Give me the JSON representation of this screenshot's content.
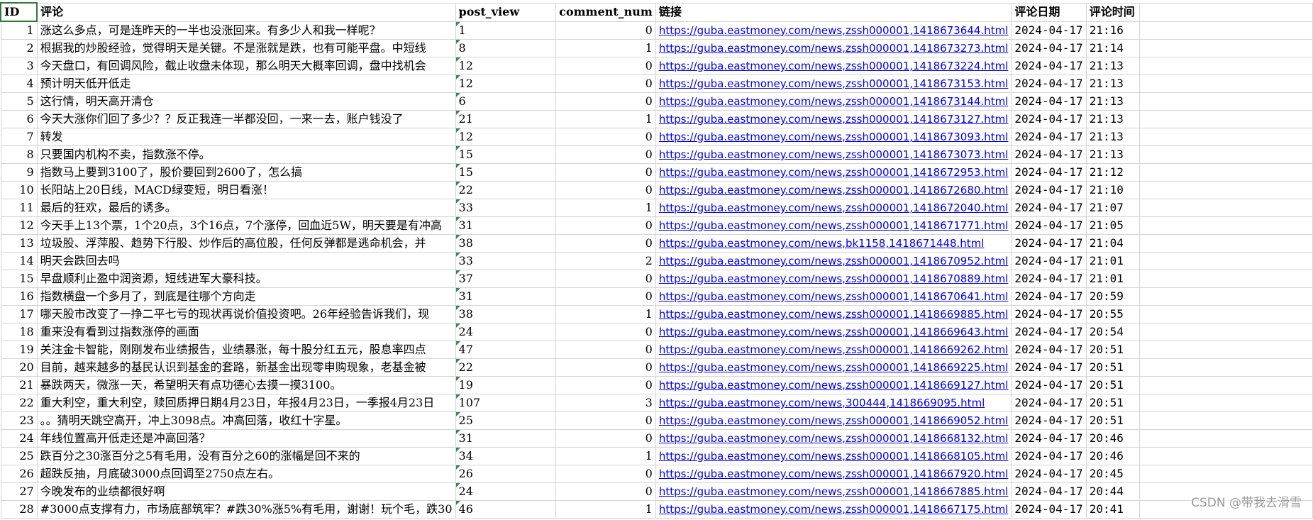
{
  "headers": [
    "ID",
    "评论",
    "post_view",
    "comment_num",
    "链接",
    "评论日期",
    "评论时间"
  ],
  "rows": [
    {
      "id": "1",
      "comment": "涨这么多点，可是连昨天的一半也没涨回来。有多少人和我一样呢？",
      "views": "1",
      "comments": "0",
      "link": "https://guba.eastmoney.com/news,zssh000001,1418673644.html",
      "date": "2024-04-17",
      "time": "21:16"
    },
    {
      "id": "2",
      "comment": "根据我的炒股经验，觉得明天是关键。不是涨就是跌，也有可能平盘。中短线",
      "views": "8",
      "comments": "1",
      "link": "https://guba.eastmoney.com/news,zssh000001,1418673273.html",
      "date": "2024-04-17",
      "time": "21:14"
    },
    {
      "id": "3",
      "comment": "今天盘口，有回调风险，截止收盘未体现，那么明天大概率回调，盘中找机会",
      "views": "12",
      "comments": "0",
      "link": "https://guba.eastmoney.com/news,zssh000001,1418673224.html",
      "date": "2024-04-17",
      "time": "21:13"
    },
    {
      "id": "4",
      "comment": "预计明天低开低走",
      "views": "12",
      "comments": "0",
      "link": "https://guba.eastmoney.com/news,zssh000001,1418673153.html",
      "date": "2024-04-17",
      "time": "21:13"
    },
    {
      "id": "5",
      "comment": "这行情，明天高开清仓",
      "views": "6",
      "comments": "0",
      "link": "https://guba.eastmoney.com/news,zssh000001,1418673144.html",
      "date": "2024-04-17",
      "time": "21:13"
    },
    {
      "id": "6",
      "comment": "今天大涨你们回了多少？？反正我连一半都没回，一来一去，账户钱没了",
      "views": "21",
      "comments": "1",
      "link": "https://guba.eastmoney.com/news,zssh000001,1418673127.html",
      "date": "2024-04-17",
      "time": "21:13"
    },
    {
      "id": "7",
      "comment": "转发",
      "views": "12",
      "comments": "0",
      "link": "https://guba.eastmoney.com/news,zssh000001,1418673093.html",
      "date": "2024-04-17",
      "time": "21:13"
    },
    {
      "id": "8",
      "comment": "只要国内机构不卖，指数涨不停。",
      "views": "15",
      "comments": "0",
      "link": "https://guba.eastmoney.com/news,zssh000001,1418673073.html",
      "date": "2024-04-17",
      "time": "21:13"
    },
    {
      "id": "9",
      "comment": "指数马上要到3100了，股价要回到2600了，怎么搞",
      "views": "15",
      "comments": "0",
      "link": "https://guba.eastmoney.com/news,zssh000001,1418672953.html",
      "date": "2024-04-17",
      "time": "21:12"
    },
    {
      "id": "10",
      "comment": "长阳站上20日线，MACD绿变短，明日看涨！",
      "views": "22",
      "comments": "0",
      "link": "https://guba.eastmoney.com/news,zssh000001,1418672680.html",
      "date": "2024-04-17",
      "time": "21:10"
    },
    {
      "id": "11",
      "comment": "最后的狂欢，最后的诱多。",
      "views": "33",
      "comments": "1",
      "link": "https://guba.eastmoney.com/news,zssh000001,1418672040.html",
      "date": "2024-04-17",
      "time": "21:07"
    },
    {
      "id": "12",
      "comment": "今天手上13个票，1个20点，3个16点，7个涨停，回血近5W，明天要是有冲高",
      "views": "31",
      "comments": "0",
      "link": "https://guba.eastmoney.com/news,zssh000001,1418671771.html",
      "date": "2024-04-17",
      "time": "21:05"
    },
    {
      "id": "13",
      "comment": "垃圾股、浮萍股、趋势下行股、炒作后的高位股，任何反弹都是逃命机会，并",
      "views": "38",
      "comments": "0",
      "link": "https://guba.eastmoney.com/news,bk1158,1418671448.html",
      "date": "2024-04-17",
      "time": "21:04"
    },
    {
      "id": "14",
      "comment": "明天会跌回去吗",
      "views": "33",
      "comments": "2",
      "link": "https://guba.eastmoney.com/news,zssh000001,1418670952.html",
      "date": "2024-04-17",
      "time": "21:01"
    },
    {
      "id": "15",
      "comment": "早盘顺利止盈中润资源，短线进军大豪科技。",
      "views": "37",
      "comments": "0",
      "link": "https://guba.eastmoney.com/news,zssh000001,1418670889.html",
      "date": "2024-04-17",
      "time": "21:01"
    },
    {
      "id": "16",
      "comment": "指数横盘一个多月了，到底是往哪个方向走",
      "views": "31",
      "comments": "0",
      "link": "https://guba.eastmoney.com/news,zssh000001,1418670641.html",
      "date": "2024-04-17",
      "time": "20:59"
    },
    {
      "id": "17",
      "comment": "哪天股市改变了一挣二平七亏的现状再说价值投资吧。26年经验告诉我们，现",
      "views": "38",
      "comments": "1",
      "link": "https://guba.eastmoney.com/news,zssh000001,1418669885.html",
      "date": "2024-04-17",
      "time": "20:55"
    },
    {
      "id": "18",
      "comment": "重来没有看到过指数涨停的画面",
      "views": "24",
      "comments": "0",
      "link": "https://guba.eastmoney.com/news,zssh000001,1418669643.html",
      "date": "2024-04-17",
      "time": "20:54"
    },
    {
      "id": "19",
      "comment": "关注金卡智能，刚刚发布业绩报告，业绩暴涨，每十股分红五元，股息率四点",
      "views": "47",
      "comments": "0",
      "link": "https://guba.eastmoney.com/news,zssh000001,1418669262.html",
      "date": "2024-04-17",
      "time": "20:51"
    },
    {
      "id": "20",
      "comment": "目前，越来越多的基民认识到基金的套路，新基金出现零申购现象，老基金被",
      "views": "22",
      "comments": "0",
      "link": "https://guba.eastmoney.com/news,zssh000001,1418669225.html",
      "date": "2024-04-17",
      "time": "20:51"
    },
    {
      "id": "21",
      "comment": "暴跌两天，微涨一天，希望明天有点功德心去摸一摸3100。",
      "views": "19",
      "comments": "0",
      "link": "https://guba.eastmoney.com/news,zssh000001,1418669127.html",
      "date": "2024-04-17",
      "time": "20:51"
    },
    {
      "id": "22",
      "comment": "重大利空，重大利空，赎回质押日期4月23日，年报4月23日，一季报4月23日",
      "views": "107",
      "comments": "3",
      "link": "https://guba.eastmoney.com/news,300444,1418669095.html",
      "date": "2024-04-17",
      "time": "20:51"
    },
    {
      "id": "23",
      "comment": "。。猜明天跳空高开，冲上3098点。冲高回落，收红十字星。",
      "views": "25",
      "comments": "0",
      "link": "https://guba.eastmoney.com/news,zssh000001,1418669052.html",
      "date": "2024-04-17",
      "time": "20:51"
    },
    {
      "id": "24",
      "comment": "年线位置高开低走还是冲高回落？",
      "views": "31",
      "comments": "0",
      "link": "https://guba.eastmoney.com/news,zssh000001,1418668132.html",
      "date": "2024-04-17",
      "time": "20:46"
    },
    {
      "id": "25",
      "comment": "跌百分之30涨百分之5有毛用，没有百分之60的涨幅是回不来的",
      "views": "34",
      "comments": "1",
      "link": "https://guba.eastmoney.com/news,zssh000001,1418668105.html",
      "date": "2024-04-17",
      "time": "20:46"
    },
    {
      "id": "26",
      "comment": "超跌反抽，月底破3000点回调至2750点左右。",
      "views": "26",
      "comments": "0",
      "link": "https://guba.eastmoney.com/news,zssh000001,1418667920.html",
      "date": "2024-04-17",
      "time": "20:45"
    },
    {
      "id": "27",
      "comment": "今晚发布的业绩都很好啊",
      "views": "24",
      "comments": "0",
      "link": "https://guba.eastmoney.com/news,zssh000001,1418667885.html",
      "date": "2024-04-17",
      "time": "20:44"
    },
    {
      "id": "28",
      "comment": "#3000点支撑有力，市场底部筑牢？#跌30%涨5%有毛用，谢谢！玩个毛，跌30",
      "views": "46",
      "comments": "1",
      "link": "https://guba.eastmoney.com/news,zssh000001,1418667175.html",
      "date": "2024-04-17",
      "time": "20:41"
    }
  ],
  "watermark": "CSDN @带我去滑雪"
}
